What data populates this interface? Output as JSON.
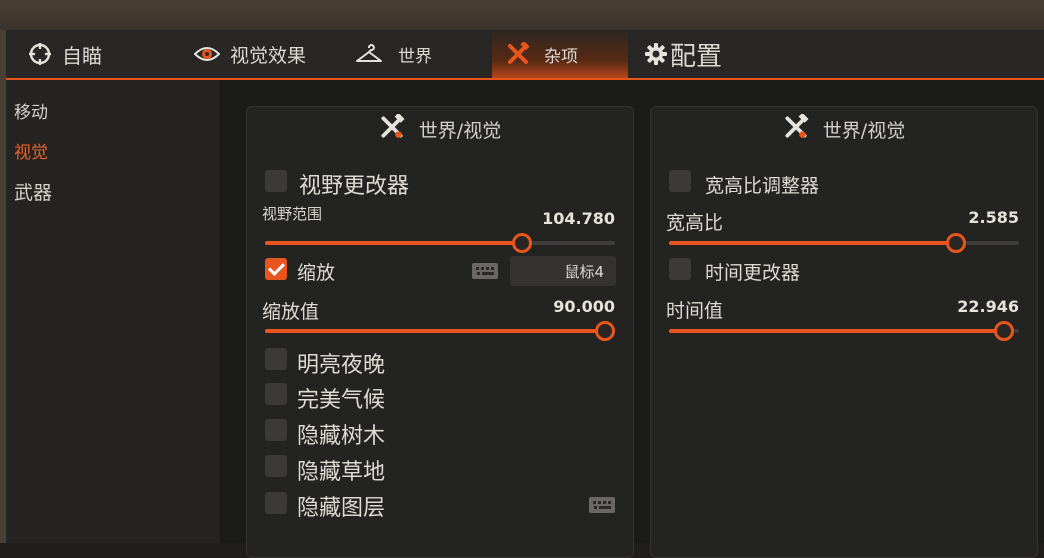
{
  "theme": {
    "accent": "#e8561e",
    "active_text": "#e8642c",
    "background": "#1b1b1a",
    "panel": "#232322"
  },
  "tabs": [
    {
      "label": "自瞄",
      "icon": "crosshair-icon"
    },
    {
      "label": "视觉效果",
      "icon": "eye-icon"
    },
    {
      "label": "世界",
      "icon": "hanger-icon"
    },
    {
      "label": "杂项",
      "icon": "tools-icon",
      "active": true
    },
    {
      "label": "配置",
      "icon": "gear-icon"
    }
  ],
  "sidebar": {
    "items": [
      {
        "label": "移动"
      },
      {
        "label": "视觉",
        "active": true
      },
      {
        "label": "武器"
      }
    ]
  },
  "left_panel": {
    "title": "世界/视觉",
    "title_icon": "tools-icon",
    "fov_changer": {
      "label": "视野更改器",
      "checked": false
    },
    "fov_range": {
      "label": "视野范围",
      "value": "104.780",
      "fill_fraction": 0.735
    },
    "zoom": {
      "label": "缩放",
      "checked": true,
      "keybind": "鼠标4",
      "keybind_icon": "keyboard-icon"
    },
    "zoom_value": {
      "label": "缩放值",
      "value": "90.000",
      "fill_fraction": 1.0
    },
    "bright_night": {
      "label": "明亮夜晚",
      "checked": false
    },
    "perfect_weather": {
      "label": "完美气候",
      "checked": false
    },
    "hide_trees": {
      "label": "隐藏树木",
      "checked": false
    },
    "hide_grass": {
      "label": "隐藏草地",
      "checked": false
    },
    "hide_layers": {
      "label": "隐藏图层",
      "checked": false,
      "keybind_icon": "keyboard-icon"
    }
  },
  "right_panel": {
    "title": "世界/视觉",
    "title_icon": "tools-icon",
    "aspect_changer": {
      "label": "宽高比调整器",
      "checked": false
    },
    "aspect_ratio": {
      "label": "宽高比",
      "value": "2.585",
      "fill_fraction": 0.82
    },
    "time_changer": {
      "label": "时间更改器",
      "checked": false
    },
    "time_value": {
      "label": "时间值",
      "value": "22.946",
      "fill_fraction": 0.956
    }
  }
}
